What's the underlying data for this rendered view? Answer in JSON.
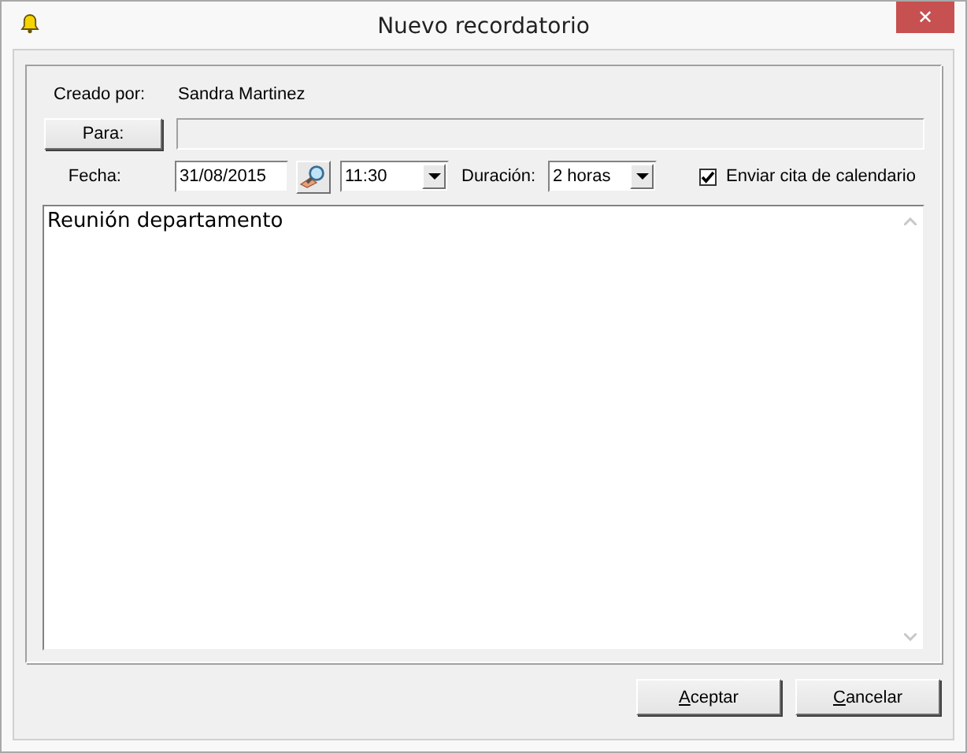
{
  "window": {
    "title": "Nuevo recordatorio",
    "close": "✕"
  },
  "created_by": {
    "label": "Creado por:",
    "value": "Sandra Martinez"
  },
  "to": {
    "button": "Para:"
  },
  "date": {
    "label": "Fecha:",
    "value": "31/08/2015"
  },
  "time": {
    "value": "11:30"
  },
  "duration": {
    "label": "Duración:",
    "value": "2 horas"
  },
  "send_calendar": {
    "label": "Enviar cita de calendario",
    "checked": true
  },
  "body": {
    "value": "Reunión departamento"
  },
  "buttons": [
    {
      "label": "Aceptar"
    },
    {
      "label": "Cancelar"
    }
  ]
}
